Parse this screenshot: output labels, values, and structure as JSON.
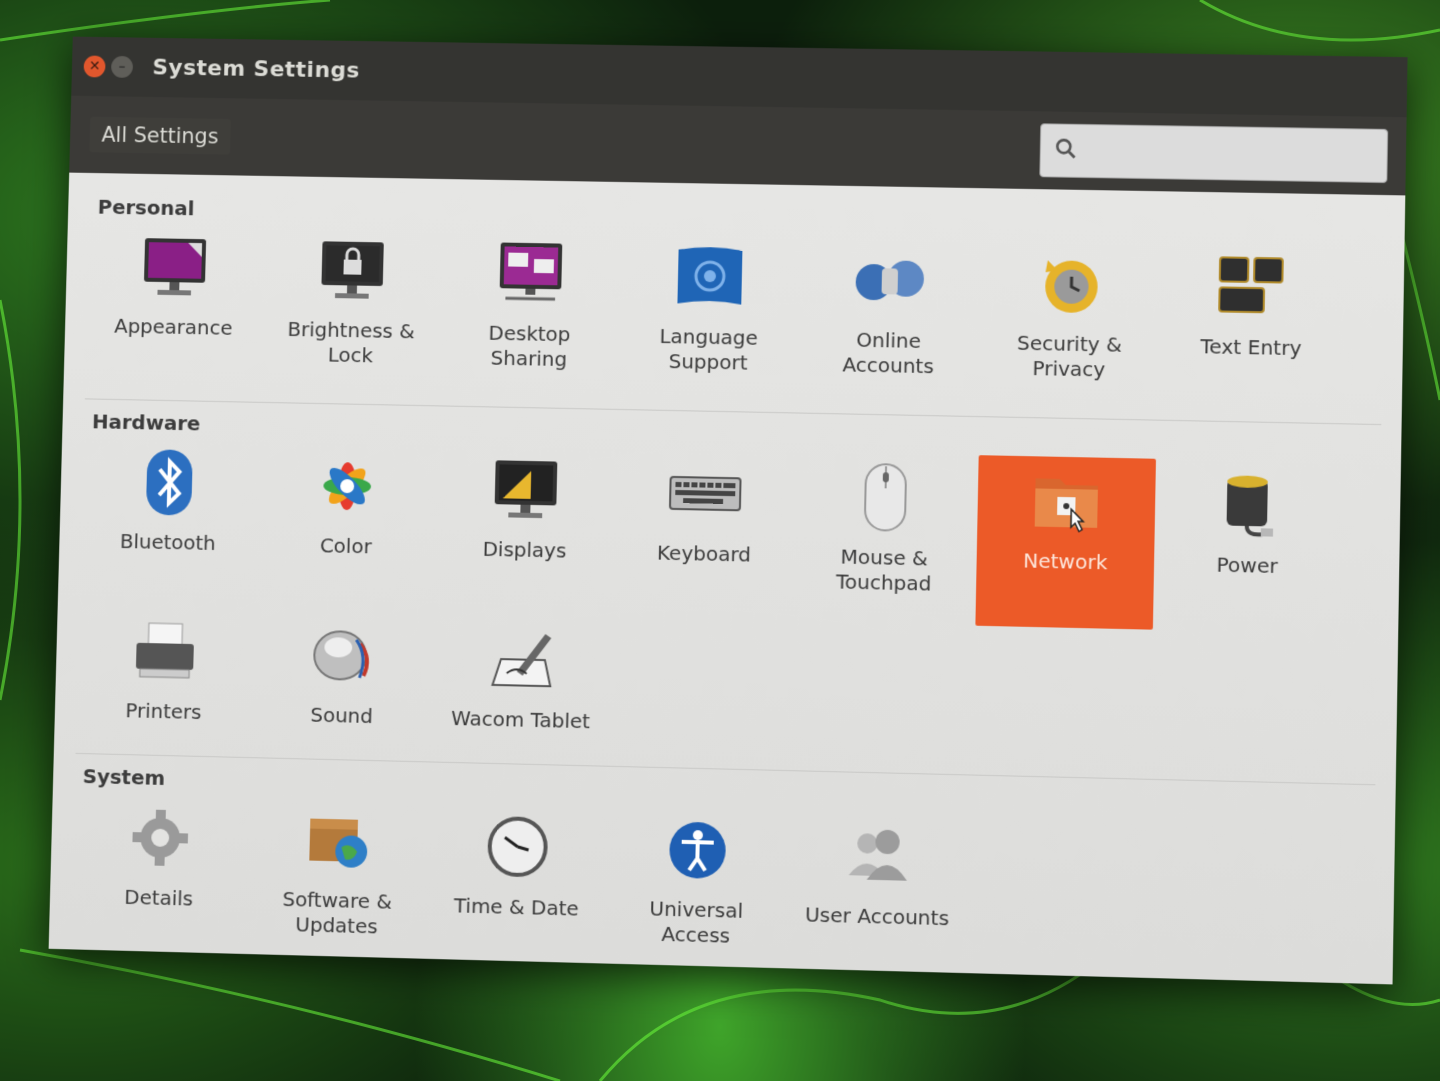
{
  "window": {
    "title": "System Settings"
  },
  "toolbar": {
    "all_settings": "All Settings",
    "search_placeholder": ""
  },
  "sections": {
    "personal": {
      "title": "Personal",
      "items": [
        "Appearance",
        "Brightness & Lock",
        "Desktop Sharing",
        "Language Support",
        "Online Accounts",
        "Security & Privacy",
        "Text Entry"
      ]
    },
    "hardware": {
      "title": "Hardware",
      "items": [
        "Bluetooth",
        "Color",
        "Displays",
        "Keyboard",
        "Mouse & Touchpad",
        "Network",
        "Power",
        "Printers",
        "Sound",
        "Wacom Tablet"
      ]
    },
    "system": {
      "title": "System",
      "items": [
        "Details",
        "Software & Updates",
        "Time & Date",
        "Universal Access",
        "User Accounts"
      ]
    }
  },
  "selected": "Network",
  "colors": {
    "selection": "#ec5a28",
    "titlebar": "#343431",
    "content": "#e3e3e1"
  }
}
